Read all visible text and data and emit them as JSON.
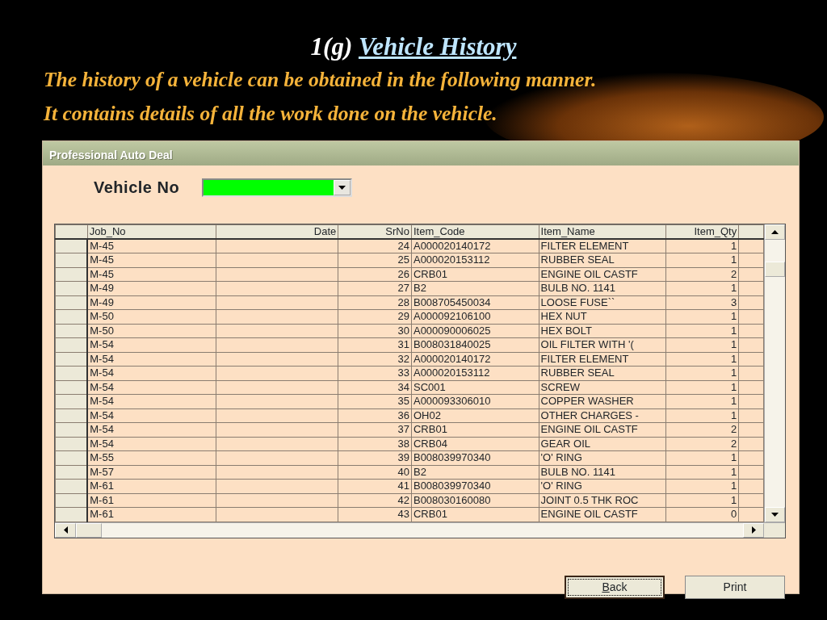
{
  "slide": {
    "title_prefix": "1(g)",
    "title_link": "Vehicle History",
    "subtitle_lines": [
      "The history of a vehicle can be obtained in the following manner.",
      "It contains details of all the work done on the vehicle."
    ]
  },
  "window": {
    "title": "Professional Auto Deal"
  },
  "vehicle_field": {
    "label": "Vehicle No"
  },
  "table": {
    "columns": [
      "Job_No",
      "Date",
      "SrNo",
      "Item_Code",
      "Item_Name",
      "Item_Qty"
    ],
    "rows": [
      {
        "job_no": "M-45",
        "sr_no": "24",
        "item_code": "A000020140172",
        "item_name": "FILTER ELEMENT",
        "item_qty": "1"
      },
      {
        "job_no": "M-45",
        "sr_no": "25",
        "item_code": "A000020153112",
        "item_name": "RUBBER SEAL",
        "item_qty": "1"
      },
      {
        "job_no": "M-45",
        "sr_no": "26",
        "item_code": "CRB01",
        "item_name": "ENGINE OIL CASTF",
        "item_qty": "2"
      },
      {
        "job_no": "M-49",
        "sr_no": "27",
        "item_code": "B2",
        "item_name": "BULB  NO.  1141",
        "item_qty": "1"
      },
      {
        "job_no": "M-49",
        "sr_no": "28",
        "item_code": "B008705450034",
        "item_name": "LOOSE  FUSE``",
        "item_qty": "3"
      },
      {
        "job_no": "M-50",
        "sr_no": "29",
        "item_code": "A000092106100",
        "item_name": "HEX NUT",
        "item_qty": "1"
      },
      {
        "job_no": "M-50",
        "sr_no": "30",
        "item_code": "A000090006025",
        "item_name": "HEX BOLT",
        "item_qty": "1"
      },
      {
        "job_no": "M-54",
        "sr_no": "31",
        "item_code": "B008031840025",
        "item_name": "OIL FILTER WITH '(",
        "item_qty": "1"
      },
      {
        "job_no": "M-54",
        "sr_no": "32",
        "item_code": "A000020140172",
        "item_name": "FILTER ELEMENT",
        "item_qty": "1"
      },
      {
        "job_no": "M-54",
        "sr_no": "33",
        "item_code": "A000020153112",
        "item_name": "RUBBER SEAL",
        "item_qty": "1"
      },
      {
        "job_no": "M-54",
        "sr_no": "34",
        "item_code": "SC001",
        "item_name": "SCREW",
        "item_qty": "1"
      },
      {
        "job_no": "M-54",
        "sr_no": "35",
        "item_code": "A000093306010",
        "item_name": "COPPER WASHER",
        "item_qty": "1"
      },
      {
        "job_no": "M-54",
        "sr_no": "36",
        "item_code": "OH02",
        "item_name": "OTHER CHARGES -",
        "item_qty": "1"
      },
      {
        "job_no": "M-54",
        "sr_no": "37",
        "item_code": "CRB01",
        "item_name": "ENGINE OIL CASTF",
        "item_qty": "2"
      },
      {
        "job_no": "M-54",
        "sr_no": "38",
        "item_code": "CRB04",
        "item_name": "GEAR OIL",
        "item_qty": "2"
      },
      {
        "job_no": "M-55",
        "sr_no": "39",
        "item_code": "B008039970340",
        "item_name": "'O' RING",
        "item_qty": "1"
      },
      {
        "job_no": "M-57",
        "sr_no": "40",
        "item_code": "B2",
        "item_name": "BULB  NO.  1141",
        "item_qty": "1"
      },
      {
        "job_no": "M-61",
        "sr_no": "41",
        "item_code": "B008039970340",
        "item_name": "'O' RING",
        "item_qty": "1"
      },
      {
        "job_no": "M-61",
        "sr_no": "42",
        "item_code": "B008030160080",
        "item_name": "JOINT 0.5 THK ROC",
        "item_qty": "1"
      },
      {
        "job_no": "M-61",
        "sr_no": "43",
        "item_code": "CRB01",
        "item_name": "ENGINE OIL CASTF",
        "item_qty": "0"
      }
    ]
  },
  "buttons": [
    {
      "underlined": "B",
      "rest": "ack",
      "focused": true
    },
    {
      "rest": "Print",
      "focused": false
    }
  ]
}
